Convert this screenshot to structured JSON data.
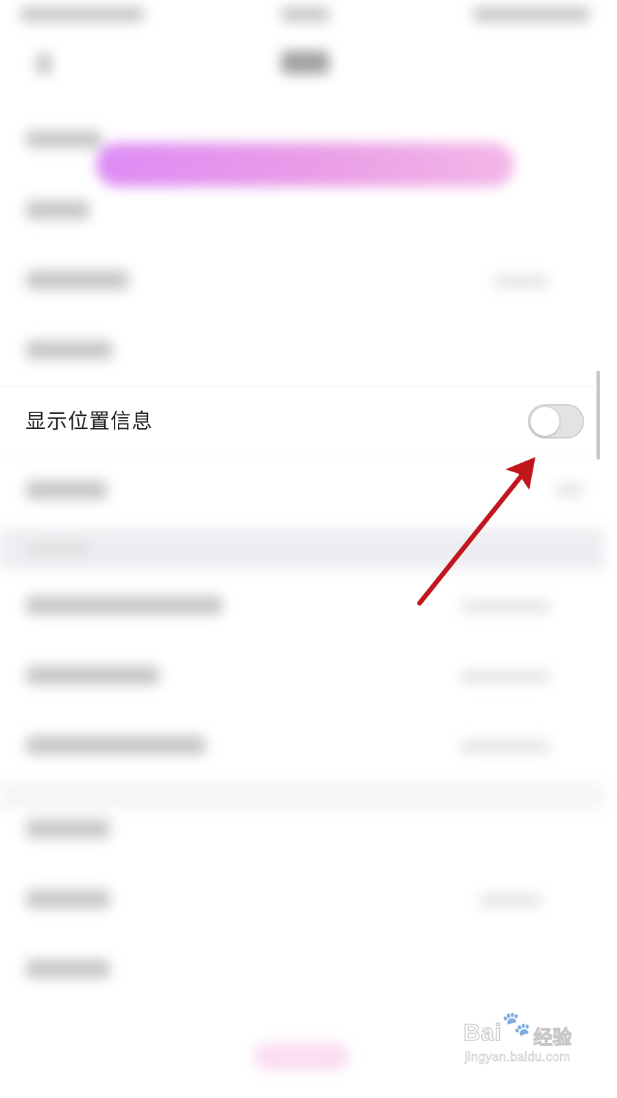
{
  "settings_row": {
    "label": "显示位置信息",
    "toggle_on": false
  },
  "watermark": {
    "brand": "Bai",
    "paw_symbol": "🐾",
    "cn": "经验",
    "url": "jingyan.baidu.com"
  },
  "colors": {
    "annotation_arrow": "#c0161c",
    "banner_start": "#dd8cf5",
    "banner_end": "#f3b7e8",
    "toggle_off_track": "#e3e3e3"
  }
}
